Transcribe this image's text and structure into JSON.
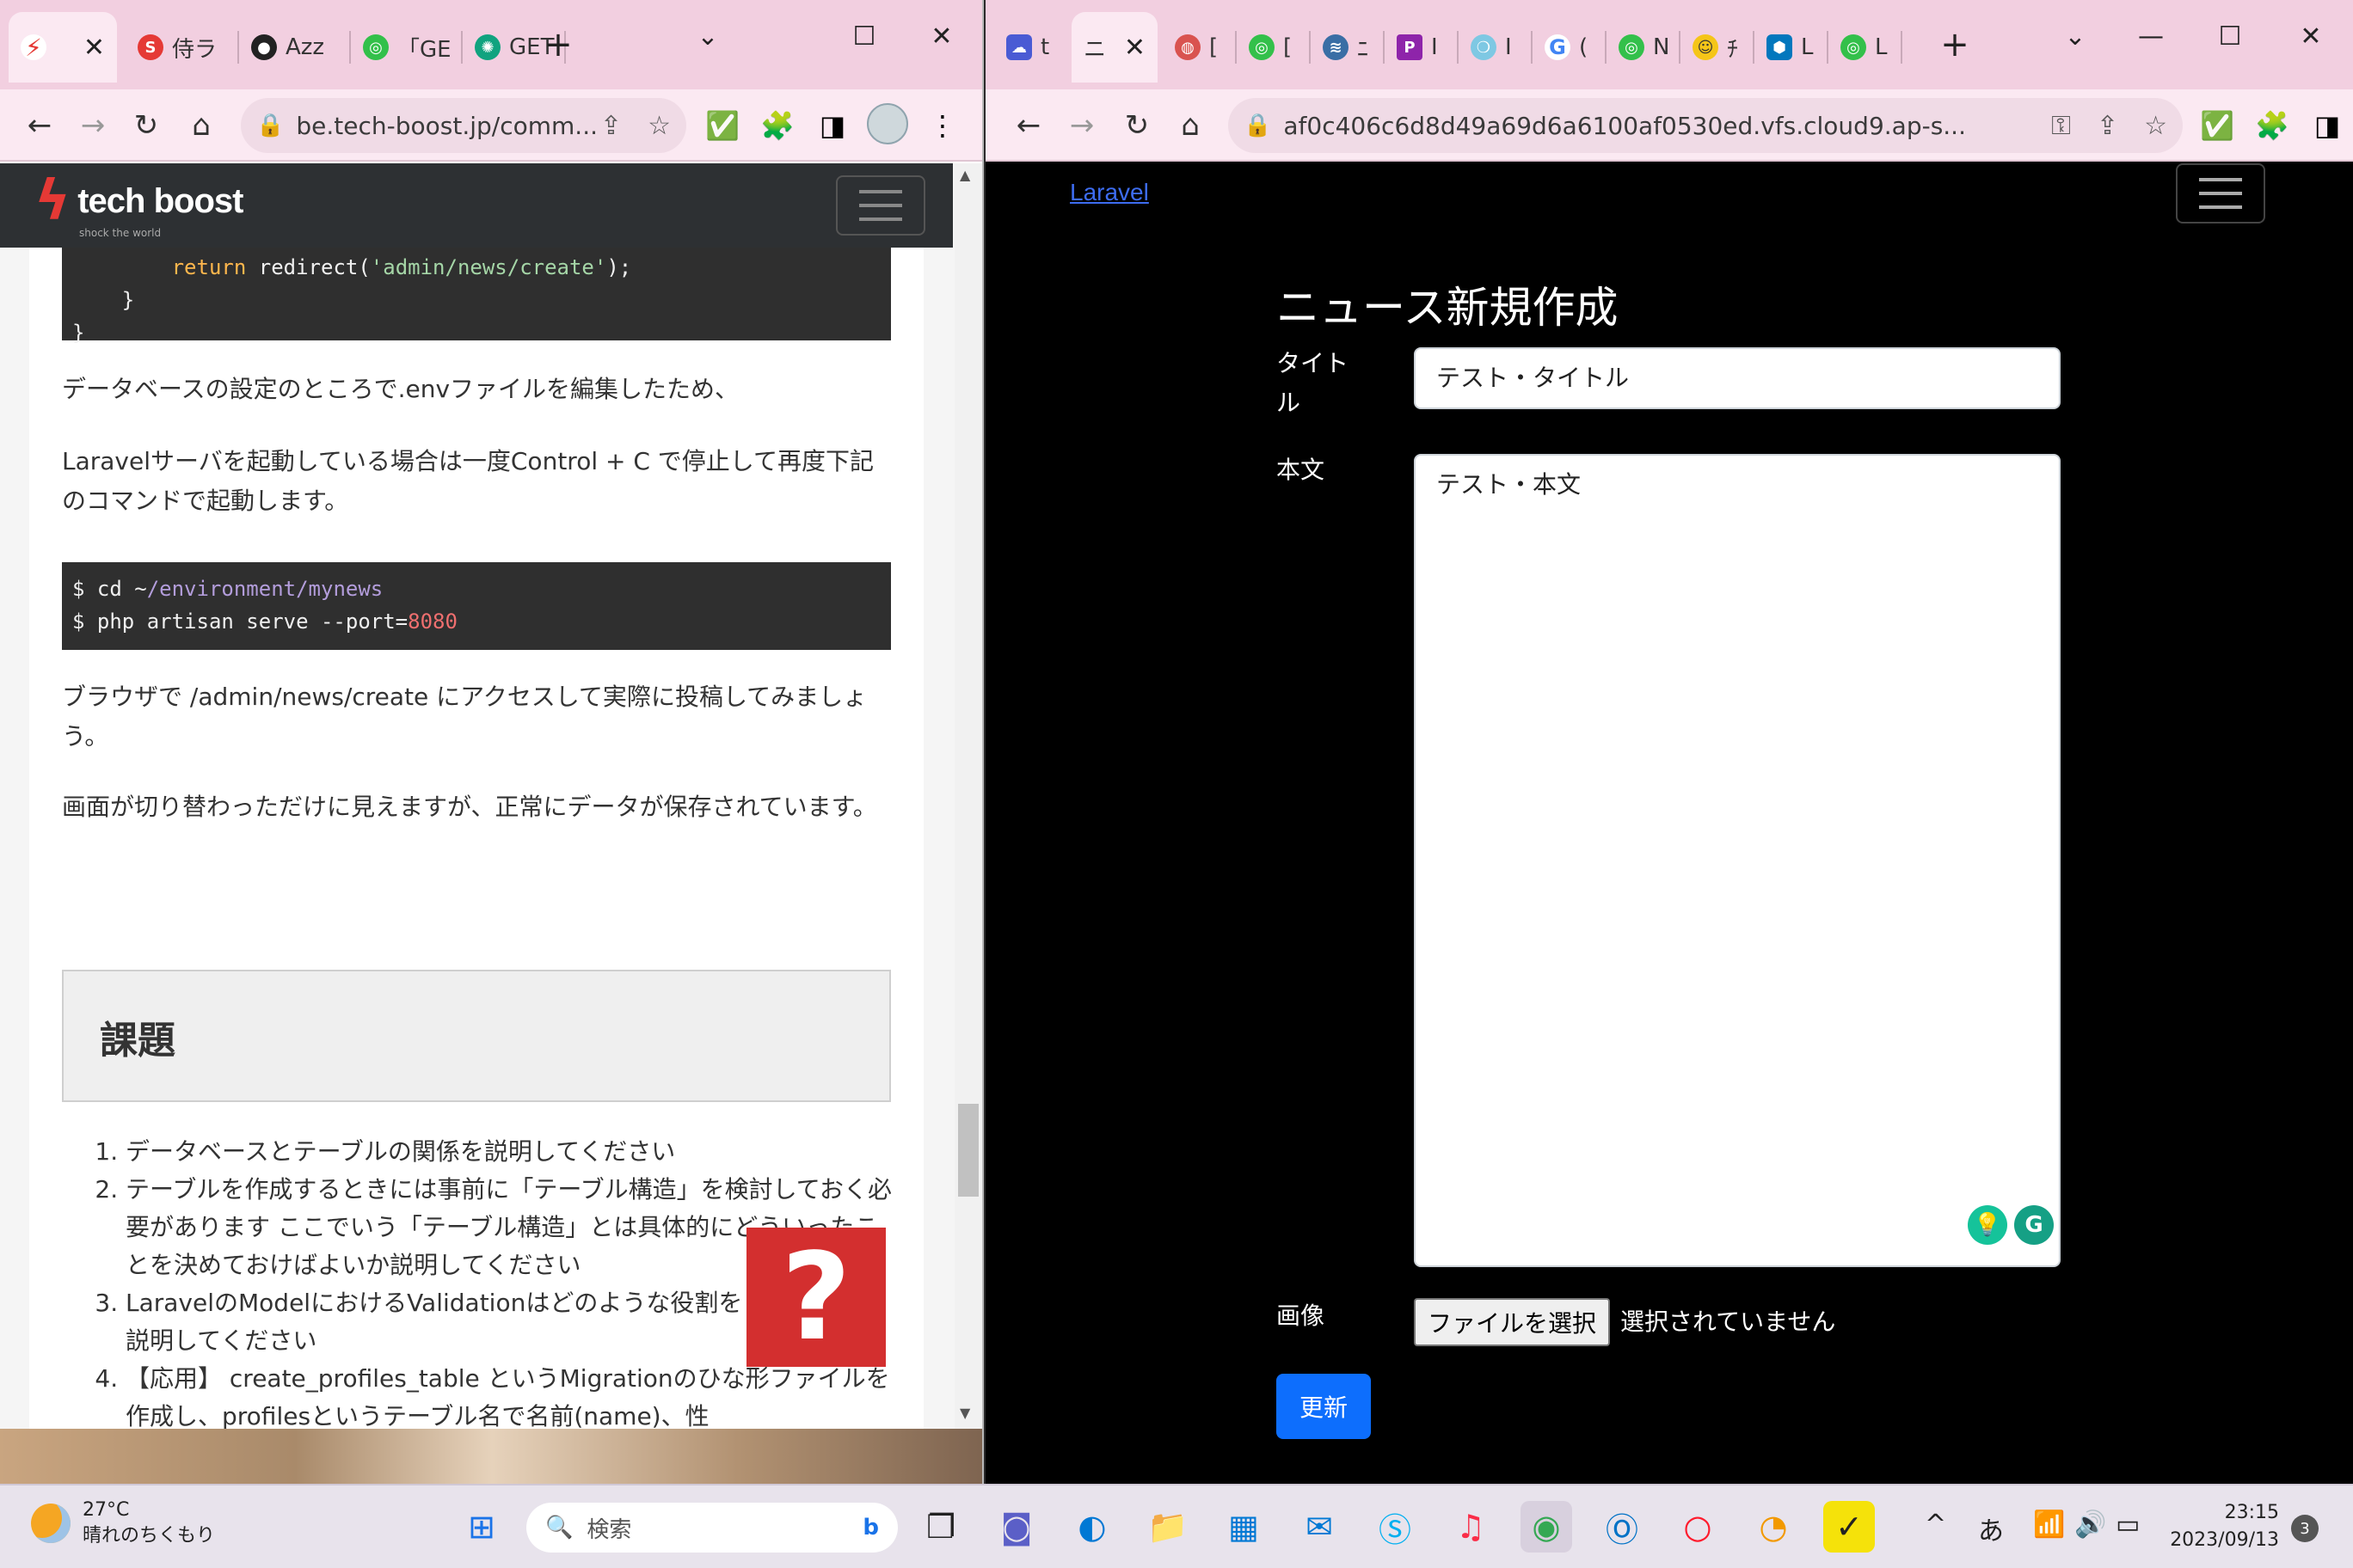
{
  "left_window": {
    "tabs": [
      {
        "label": "",
        "icon": "tech-boost-favicon",
        "color": "#e53935",
        "active": true
      },
      {
        "label": "侍ラ",
        "icon": "samurai-favicon",
        "color": "#e53935"
      },
      {
        "label": "Azz",
        "icon": "github-favicon",
        "color": "#222222"
      },
      {
        "label": "「GE",
        "icon": "green-circle-favicon",
        "color": "#33c04a"
      },
      {
        "label": "GET",
        "icon": "chatgpt-favicon",
        "color": "#10a37f"
      }
    ],
    "url": "be.tech-boost.jp/comm...",
    "page": {
      "logo": "tech boost",
      "logo_tagline": "shock the world",
      "code1": {
        "line1_pre": "        ",
        "line1_kw": "return",
        "line1_mid": " redirect(",
        "line1_str": "'admin/news/create'",
        "line1_end": ");",
        "line2": "    }",
        "line3": "}"
      },
      "para1": "データベースの設定のところで.envファイルを編集したため、",
      "para2": "Laravelサーバを起動している場合は一度Control + C で停止して再度下記のコマンドで起動します。",
      "code2": {
        "line1_pre": "$ cd ~",
        "line1_path": "/environment/mynews",
        "line2_pre": "$ php artisan serve --port=",
        "line2_num": "8080"
      },
      "para3": "ブラウザで /admin/news/create にアクセスして実際に投稿してみましょう。",
      "para4": "画面が切り替わっただけに見えますが、正常にデータが保存されています。",
      "kadai_title": "課題",
      "tasks": [
        "データベースとテーブルの関係を説明してください",
        "テーブルを作成するときには事前に「テーブル構造」を検討しておく必要があります ここでいう「テーブル構造」とは具体的にどういったことを決めておけばよいか説明してください",
        "LaravelのModelにおけるValidationはどのような役割をしているか、説明してください",
        "【応用】 create_profiles_table というMigrationのひな形ファイルを作成し、profilesというテーブル名で名前(name)、性"
      ],
      "help_badge": "?"
    }
  },
  "right_window": {
    "tabs": [
      {
        "label": "t",
        "icon": "cloud9-favicon",
        "color": "#4a5bd4"
      },
      {
        "label": "ニ",
        "icon": "none",
        "color": "#fbe9f2",
        "active": true
      },
      {
        "label": "[",
        "icon": "globe-favicon",
        "color": "#d9534f"
      },
      {
        "label": "[",
        "icon": "green-circle-favicon",
        "color": "#33c04a"
      },
      {
        "label": "ﾆ",
        "icon": "wind-favicon",
        "color": "#3a6ea5"
      },
      {
        "label": "I",
        "icon": "p-favicon",
        "color": "#8e24aa"
      },
      {
        "label": "I",
        "icon": "bubble-favicon",
        "color": "#7ec8e3"
      },
      {
        "label": "(",
        "icon": "google-favicon",
        "color": "#4285f4"
      },
      {
        "label": "N",
        "icon": "green-circle-favicon",
        "color": "#33c04a"
      },
      {
        "label": "ﾁ",
        "icon": "smiley-favicon",
        "color": "#f5c518"
      },
      {
        "label": "L",
        "icon": "hex-favicon",
        "color": "#0277bd"
      },
      {
        "label": "L",
        "icon": "green-circle-favicon",
        "color": "#33c04a"
      }
    ],
    "url": "af0c406c6d8d49a69d6a6100af0530ed.vfs.cloud9.ap-s...",
    "page": {
      "brand_link": "Laravel",
      "heading": "ニュース新規作成",
      "title_label_line1": "タイト",
      "title_label_line2": "ル",
      "title_value": "テスト・タイトル",
      "body_label": "本文",
      "body_value": "テスト・本文",
      "image_label": "画像",
      "file_button": "ファイルを選択",
      "file_status": "選択されていません",
      "submit_button": "更新"
    }
  },
  "taskbar": {
    "weather_temp": "27°C",
    "weather_desc": "晴れのちくもり",
    "search_placeholder": "検索",
    "ime": "あ",
    "time": "23:15",
    "date": "2023/09/13",
    "notifications": "3"
  }
}
